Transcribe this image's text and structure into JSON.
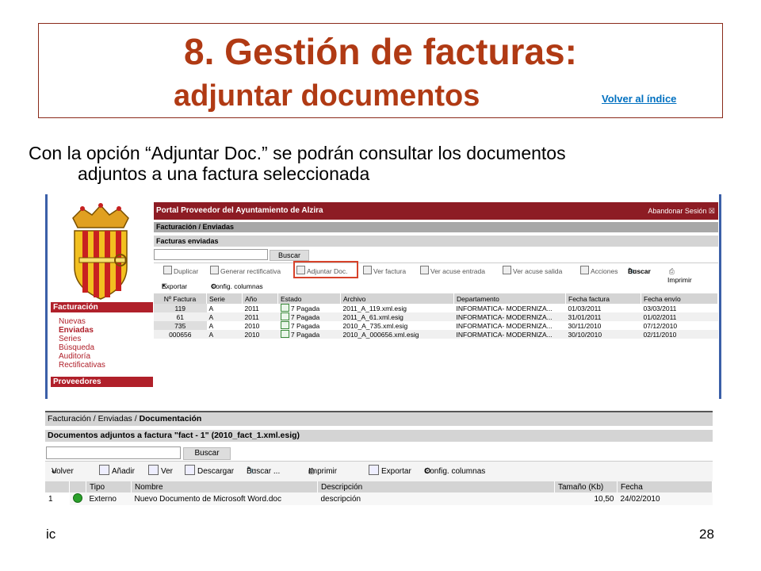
{
  "slide": {
    "title_line1": "8. Gestión de facturas:",
    "title_line2": "adjuntar documentos",
    "index_link": "Volver al índice",
    "intro_line1": "Con la opción “Adjuntar Doc.” se podrán consultar los documentos",
    "intro_line2": "adjuntos a una factura seleccionada",
    "footer_left": "ic",
    "page_number": "28",
    "title_color": "#b03a14",
    "link_color": "#0070c0"
  },
  "screen1": {
    "portal_title": "Portal Proveedor del Ayuntamiento de Alzira",
    "logout": "Abandonar Sesión",
    "breadcrumb": "Facturación / Enviadas",
    "section": "Facturas enviadas",
    "search_button": "Buscar",
    "nav_facturacion": "Facturación",
    "nav_proveedores": "Proveedores",
    "nav_items": [
      "Nuevas",
      "Enviadas",
      "Series",
      "Búsqueda",
      "Auditoría",
      "Rectificativas"
    ],
    "toolbar": [
      "Duplicar",
      "Generar rectificativa",
      "Adjuntar Doc.",
      "Ver factura",
      "Ver acuse entrada",
      "Ver acuse salida",
      "Acciones",
      "Buscar",
      "Imprimir"
    ],
    "toolbar2": [
      "Exportar",
      "Config. columnas"
    ],
    "columns": [
      "Nº Factura",
      "Serie",
      "Año",
      "Estado",
      "Archivo",
      "Departamento",
      "Fecha factura",
      "Fecha envío"
    ],
    "rows": [
      [
        "119",
        "A",
        "2011",
        "7 Pagada",
        "2011_A_119.xml.esig",
        "INFORMATICA- MODERNIZA...",
        "01/03/2011",
        "03/03/2011"
      ],
      [
        "61",
        "A",
        "2011",
        "7 Pagada",
        "2011_A_61.xml.esig",
        "INFORMATICA- MODERNIZA...",
        "31/01/2011",
        "01/02/2011"
      ],
      [
        "735",
        "A",
        "2010",
        "7 Pagada",
        "2010_A_735.xml.esig",
        "INFORMATICA- MODERNIZA...",
        "30/11/2010",
        "07/12/2010"
      ],
      [
        "000656",
        "A",
        "2010",
        "7 Pagada",
        "2010_A_000656.xml.esig",
        "INFORMATICA- MODERNIZA...",
        "30/10/2010",
        "02/11/2010"
      ]
    ],
    "accent_color": "#8d1c24"
  },
  "screen2": {
    "breadcrumb_prefix": "Facturación / Enviadas / ",
    "breadcrumb_current": "Documentación",
    "section": "Documentos adjuntos a factura \"fact - 1\" (2010_fact_1.xml.esig)",
    "search_button": "Buscar",
    "toolbar": [
      "Volver",
      "Añadir",
      "Ver",
      "Descargar",
      "Buscar ...",
      "Imprimir",
      "Exportar",
      "Config. columnas"
    ],
    "columns": [
      "Tipo",
      "Nombre",
      "Descripción",
      "Tamaño (Kb)",
      "Fecha"
    ],
    "row": {
      "index": "1",
      "tipo": "Externo",
      "nombre": "Nuevo Documento de Microsoft Word.doc",
      "descripcion": "descripción",
      "tamano": "10,50",
      "fecha": "24/02/2010"
    }
  }
}
